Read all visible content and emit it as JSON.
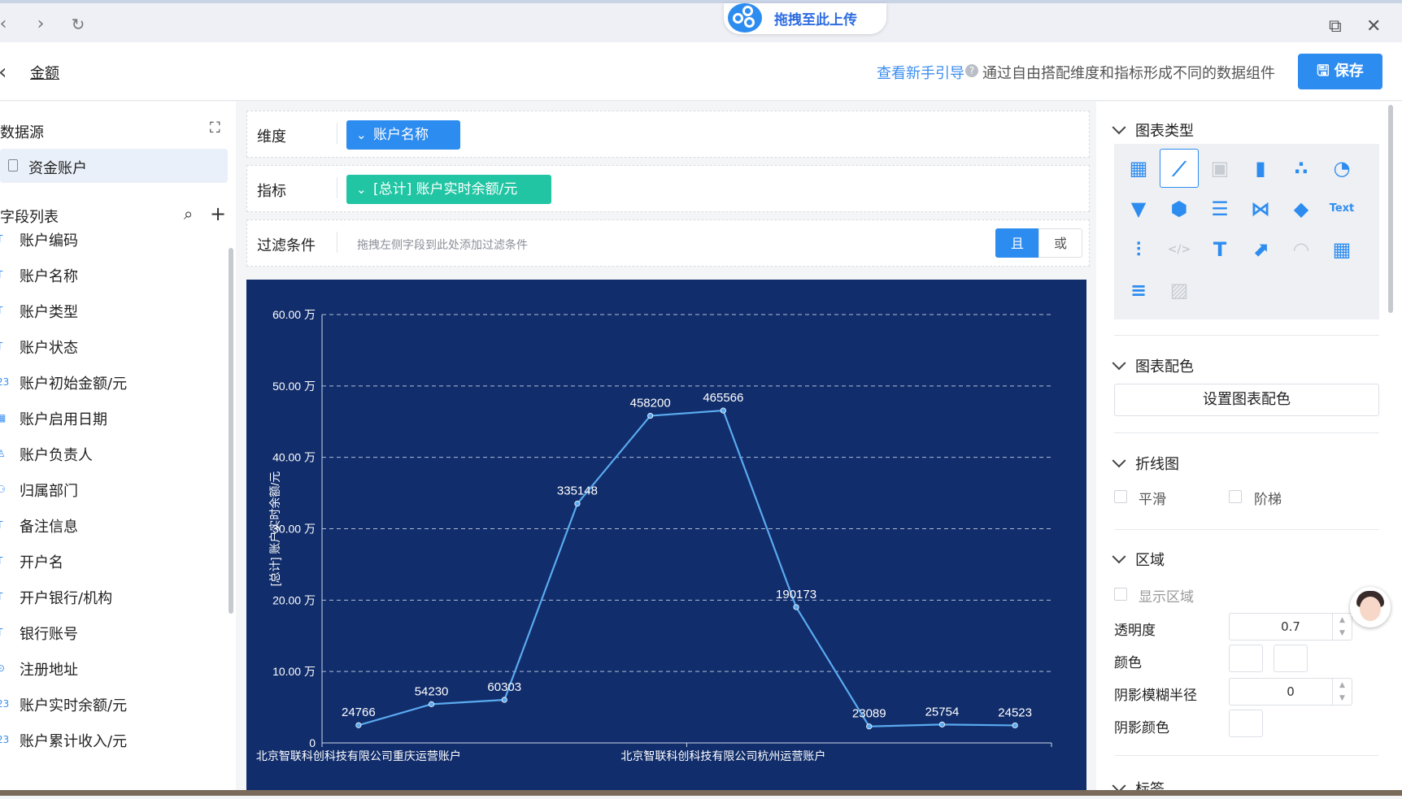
{
  "browser": {
    "upload_label": "拖拽至此上传"
  },
  "header": {
    "title": "金额",
    "guide_link": "查看新手引导",
    "guide_text": "通过自由搭配维度和指标形成不同的数据组件",
    "save_label": "保存"
  },
  "left": {
    "datasource_title": "数据源",
    "datasource_item": "资金账户",
    "fields_title": "字段列表",
    "fields": [
      {
        "name": "账户编码",
        "icon": "text-field-icon"
      },
      {
        "name": "账户名称",
        "icon": "text-field-icon"
      },
      {
        "name": "账户类型",
        "icon": "text-field-icon"
      },
      {
        "name": "账户状态",
        "icon": "text-field-icon"
      },
      {
        "name": "账户初始金额/元",
        "icon": "number-field-icon"
      },
      {
        "name": "账户启用日期",
        "icon": "date-field-icon"
      },
      {
        "name": "账户负责人",
        "icon": "user-field-icon"
      },
      {
        "name": "归属部门",
        "icon": "org-field-icon"
      },
      {
        "name": "备注信息",
        "icon": "text-field-icon"
      },
      {
        "name": "开户名",
        "icon": "text-field-icon"
      },
      {
        "name": "开户银行/机构",
        "icon": "text-field-icon"
      },
      {
        "name": "银行账号",
        "icon": "text-field-icon"
      },
      {
        "name": "注册地址",
        "icon": "location-field-icon"
      },
      {
        "name": "账户实时余额/元",
        "icon": "number-field-icon"
      },
      {
        "name": "账户累计收入/元",
        "icon": "number-field-icon"
      }
    ]
  },
  "config": {
    "dimension_label": "维度",
    "dimension_value": "账户名称",
    "metric_label": "指标",
    "metric_value": "[总计] 账户实时余额/元",
    "filter_label": "过滤条件",
    "filter_hint": "拖拽左侧字段到此处添加过滤条件",
    "and_label": "且",
    "or_label": "或"
  },
  "right": {
    "chart_type_title": "图表类型",
    "chart_color_title": "图表配色",
    "set_color_button": "设置图表配色",
    "line_title": "折线图",
    "smooth_label": "平滑",
    "step_label": "阶梯",
    "area_title": "区域",
    "show_area_label": "显示区域",
    "opacity_label": "透明度",
    "opacity_value": "0.7",
    "color_label": "颜色",
    "shadow_blur_label": "阴影模糊半径",
    "shadow_blur_value": "0",
    "shadow_color_label": "阴影颜色",
    "next_section": "标签"
  },
  "colors": {
    "chart_bg": "#112d6b",
    "line": "#5aaaf0",
    "accent": "#2d8cf0",
    "metric_chip": "#22c5a3"
  },
  "chart_data": {
    "type": "line",
    "categories": [
      "北京智联科创科技有限公司重庆运营账户",
      "",
      "",
      "",
      "",
      "北京智联科创科技有限公司杭州运营账户",
      "",
      "",
      "",
      ""
    ],
    "values": [
      24766,
      54230,
      60303,
      335148,
      458200,
      465566,
      190173,
      23089,
      25754,
      24523
    ],
    "x_tick_labels": [
      "北京智联科创科技有限公司重庆运营账户",
      "北京智联科创科技有限公司杭州运营账户"
    ],
    "ylabel": "[总计] 账户实时余额/元",
    "ylim": [
      0,
      600000
    ],
    "y_ticks": [
      "0",
      "10.00 万",
      "20.00 万",
      "30.00 万",
      "40.00 万",
      "50.00 万",
      "60.00 万"
    ],
    "grid": true
  }
}
